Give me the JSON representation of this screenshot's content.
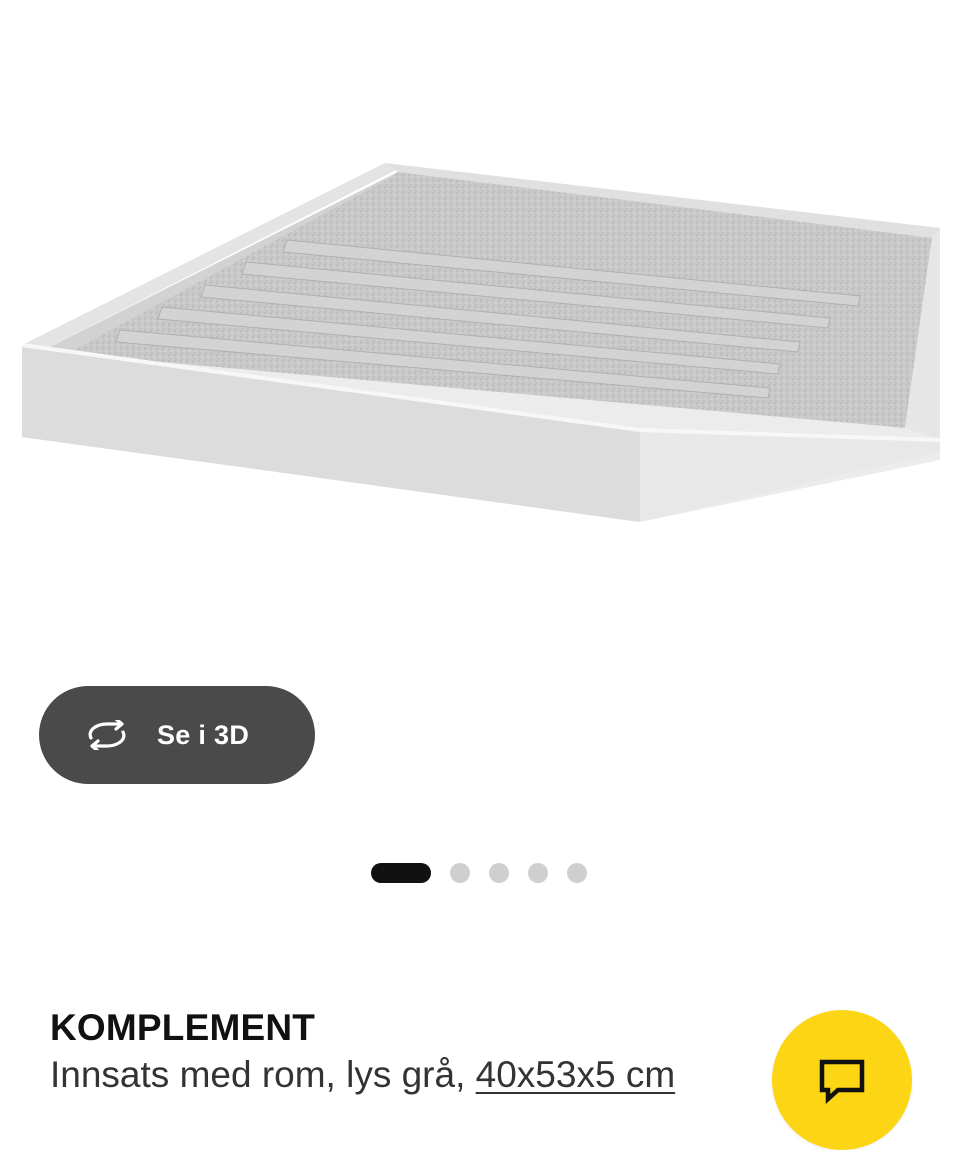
{
  "gallery": {
    "image_alt": "KOMPLEMENT Innsats med rom, lys grå",
    "view_3d_label": "Se i 3D",
    "view_3d_icon": "rotate-icon",
    "dots": [
      {
        "active": true
      },
      {
        "active": false
      },
      {
        "active": false
      },
      {
        "active": false
      },
      {
        "active": false
      }
    ]
  },
  "product": {
    "name": "KOMPLEMENT",
    "description": "Innsats med rom, lys grå,",
    "size": "40x53x5 cm"
  },
  "chat": {
    "icon": "chat-bubble-icon",
    "color": "#fcd514"
  },
  "colors": {
    "button_bg": "#4a4a4a",
    "text": "#111111",
    "accent": "#fcd514"
  }
}
